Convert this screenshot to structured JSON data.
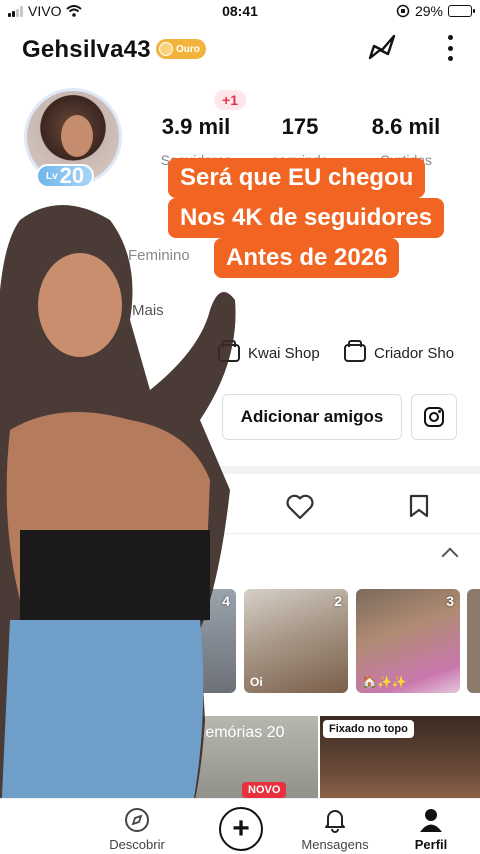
{
  "status_bar": {
    "carrier": "VIVO",
    "time": "08:41",
    "battery_percent": "29%",
    "battery_level": 0.29
  },
  "header": {
    "username": "Gehsilva43",
    "badge_label": "Ouro"
  },
  "profile": {
    "level": "20",
    "level_prefix": "Lv",
    "new_followers_badge": "+1",
    "stats": [
      {
        "value": "3.9 mil",
        "label": "Seguidores"
      },
      {
        "value": "175",
        "label": "seguindo"
      },
      {
        "value": "8.6 mil",
        "label": "Curtidas"
      }
    ],
    "gender": "Feminino",
    "more_label": "Mais"
  },
  "caption_overlay": {
    "lines": [
      "Será que EU chegou",
      "Nos 4K de seguidores",
      "Antes de 2026"
    ],
    "color": "#f26422"
  },
  "shortcuts": [
    {
      "label": "Kwai Shop",
      "icon": "shop-icon"
    },
    {
      "label": "Criador Sho",
      "icon": "shop-icon"
    }
  ],
  "actions": {
    "add_friends_label": "Adicionar amigos",
    "instagram_icon": "instagram-icon"
  },
  "thumbnails": [
    {
      "count": "4",
      "label": ""
    },
    {
      "count": "2",
      "label": "Oi"
    },
    {
      "count": "3",
      "label": "🏠✨✨"
    }
  ],
  "memories": {
    "label": "Memórias 20",
    "new_badge": "NOVO",
    "pinned_label": "Fixado no topo"
  },
  "bottom_nav": {
    "discover": "Descobrir",
    "messages": "Mensagens",
    "profile": "Perfil"
  }
}
